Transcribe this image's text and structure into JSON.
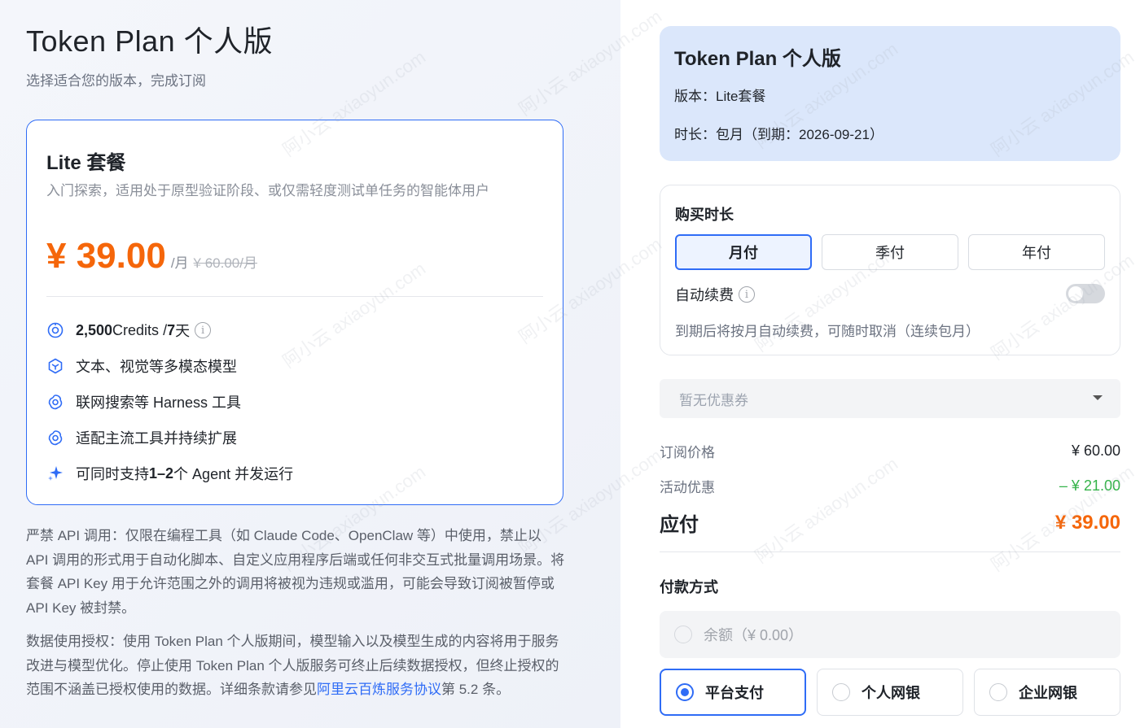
{
  "page": {
    "title": "Token Plan 个人版",
    "subtitle": "选择适合您的版本，完成订阅"
  },
  "plan": {
    "name": "Lite 套餐",
    "description": "入门探索，适用处于原型验证阶段、或仅需轻度测试单任务的智能体用户",
    "price": "¥ 39.00",
    "unit": "/月",
    "original_price": "¥ 60.00/月",
    "features": [
      {
        "icon": "credits-icon",
        "prefix": "2,500",
        "text": " Credits / ",
        "bold2": "7",
        "suffix": " 天"
      },
      {
        "icon": "cube-icon",
        "text": "文本、视觉等多模态模型"
      },
      {
        "icon": "tool-swirl-icon",
        "text": "联网搜索等 Harness 工具"
      },
      {
        "icon": "tool-swirl-icon",
        "text": "适配主流工具并持续扩展"
      },
      {
        "icon": "sparkle-icon",
        "prefix": "可同时支持 ",
        "bold": "1–2",
        "suffix": " 个 Agent 并发运行"
      }
    ]
  },
  "notices": {
    "api": "严禁 API 调用：仅限在编程工具（如 Claude Code、OpenClaw 等）中使用，禁止以 API 调用的形式用于自动化脚本、自定义应用程序后端或任何非交互式批量调用场景。将套餐 API Key 用于允许范围之外的调用将被视为违规或滥用，可能会导致订阅被暂停或 API Key 被封禁。",
    "data_prefix": "数据使用授权：使用 Token Plan 个人版期间，模型输入以及模型生成的内容将用于服务改进与模型优化。停止使用 Token Plan 个人版服务可终止后续数据授权，但终止授权的范围不涵盖已授权使用的数据。详细条款请参见",
    "data_link": "阿里云百炼服务协议",
    "data_suffix": "第 5.2 条。"
  },
  "summary": {
    "title": "Token Plan 个人版",
    "version": "版本：Lite套餐",
    "duration": "时长：包月（到期：2026-09-21）"
  },
  "purchase": {
    "label": "购买时长",
    "options": [
      "月付",
      "季付",
      "年付"
    ],
    "selected": "月付",
    "auto_renew_label": "自动续费",
    "auto_renew_on": false,
    "auto_renew_hint": "到期后将按月自动续费，可随时取消（连续包月）"
  },
  "coupon": {
    "placeholder": "暂无优惠券"
  },
  "pricing": {
    "subscription_label": "订阅价格",
    "subscription_value": "¥ 60.00",
    "discount_label": "活动优惠",
    "discount_value": "– ¥ 21.00",
    "due_label": "应付",
    "due_value": "¥ 39.00"
  },
  "payment": {
    "label": "付款方式",
    "balance": "余额（¥  0.00）",
    "options": [
      "平台支付",
      "个人网银",
      "企业网银"
    ],
    "selected": "平台支付"
  },
  "colors": {
    "accent": "#2f6cf6",
    "price": "#f5660a",
    "discount": "#35b34a",
    "summary_bg": "#dbe7fb"
  },
  "watermark": "阿小云 axiaoyun.com"
}
